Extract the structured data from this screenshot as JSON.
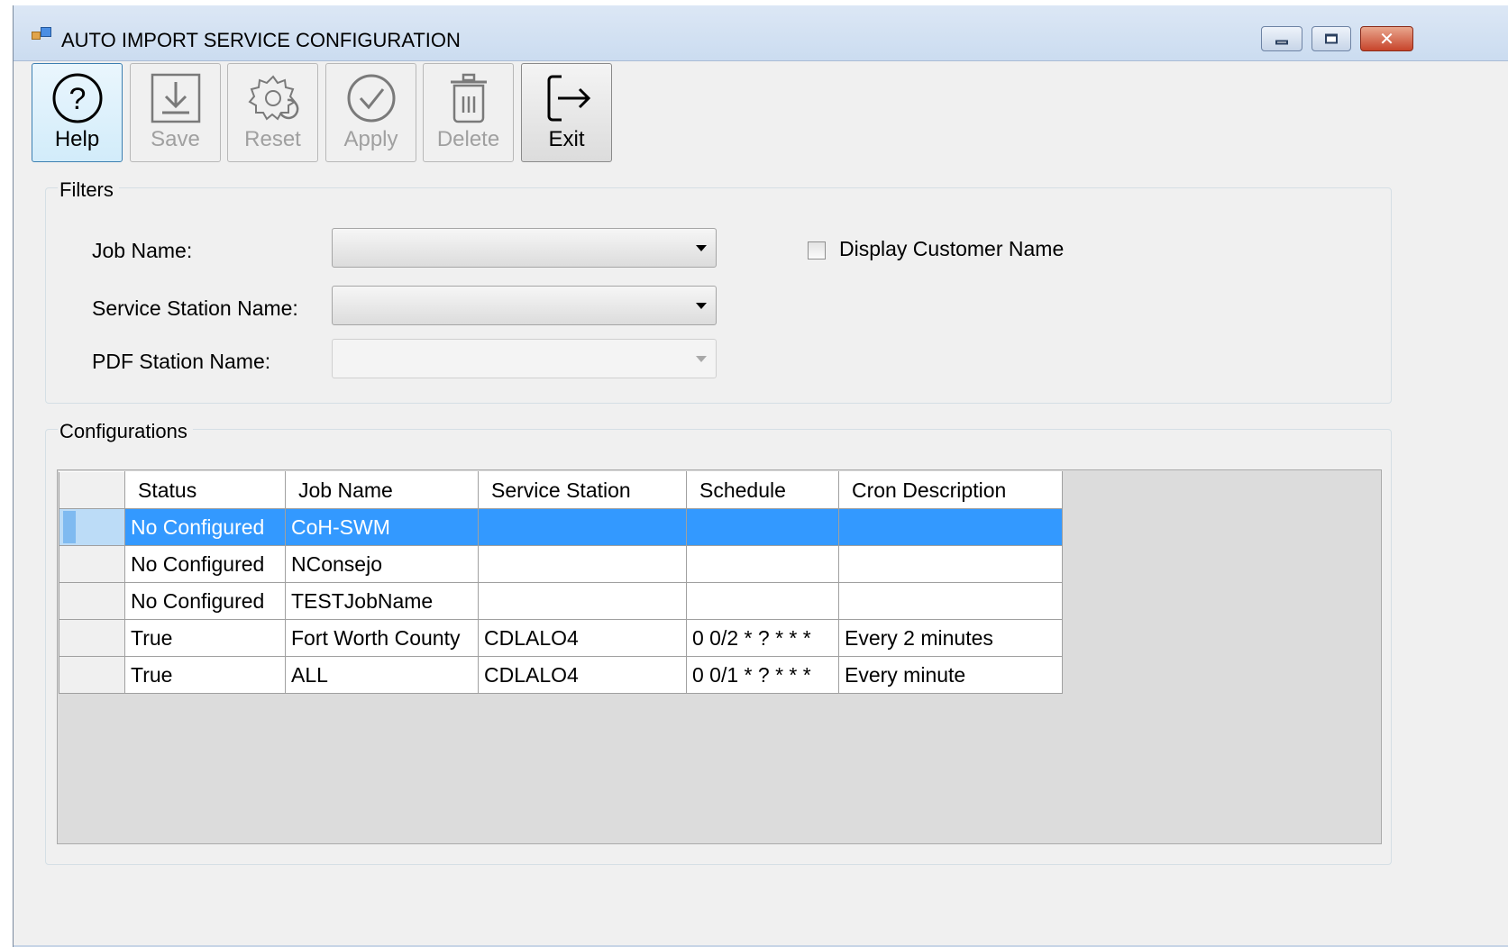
{
  "window": {
    "title": "AUTO IMPORT SERVICE CONFIGURATION",
    "close_glyph": "✕"
  },
  "toolbar": {
    "help": "Help",
    "save": "Save",
    "reset": "Reset",
    "apply": "Apply",
    "delete": "Delete",
    "exit": "Exit"
  },
  "filters": {
    "group_label": "Filters",
    "job_name_label": "Job Name:",
    "job_name_value": "",
    "service_station_label": "Service Station Name:",
    "service_station_value": "",
    "pdf_station_label": "PDF Station Name:",
    "pdf_station_value": "",
    "display_customer_label": "Display Customer Name",
    "display_customer_checked": false
  },
  "configurations": {
    "group_label": "Configurations",
    "columns": [
      "Status",
      "Job Name",
      "Service Station",
      "Schedule",
      "Cron Description"
    ],
    "rows": [
      {
        "status": "No Configured",
        "job": "CoH-SWM",
        "station": "",
        "schedule": "",
        "cron": "",
        "selected": true
      },
      {
        "status": "No Configured",
        "job": "NConsejo",
        "station": "",
        "schedule": "",
        "cron": ""
      },
      {
        "status": "No Configured",
        "job": "TESTJobName",
        "station": "",
        "schedule": "",
        "cron": ""
      },
      {
        "status": "True",
        "job": "Fort Worth County",
        "station": "CDLALO4",
        "schedule": "0 0/2 * ? * * *",
        "cron": "Every 2 minutes"
      },
      {
        "status": "True",
        "job": "ALL",
        "station": "CDLALO4",
        "schedule": "0 0/1 * ? * * *",
        "cron": "Every minute"
      }
    ]
  },
  "colors": {
    "selection": "#3399ff",
    "window_bg": "#f0f0f0",
    "grid_bg": "#dcdcdc"
  }
}
